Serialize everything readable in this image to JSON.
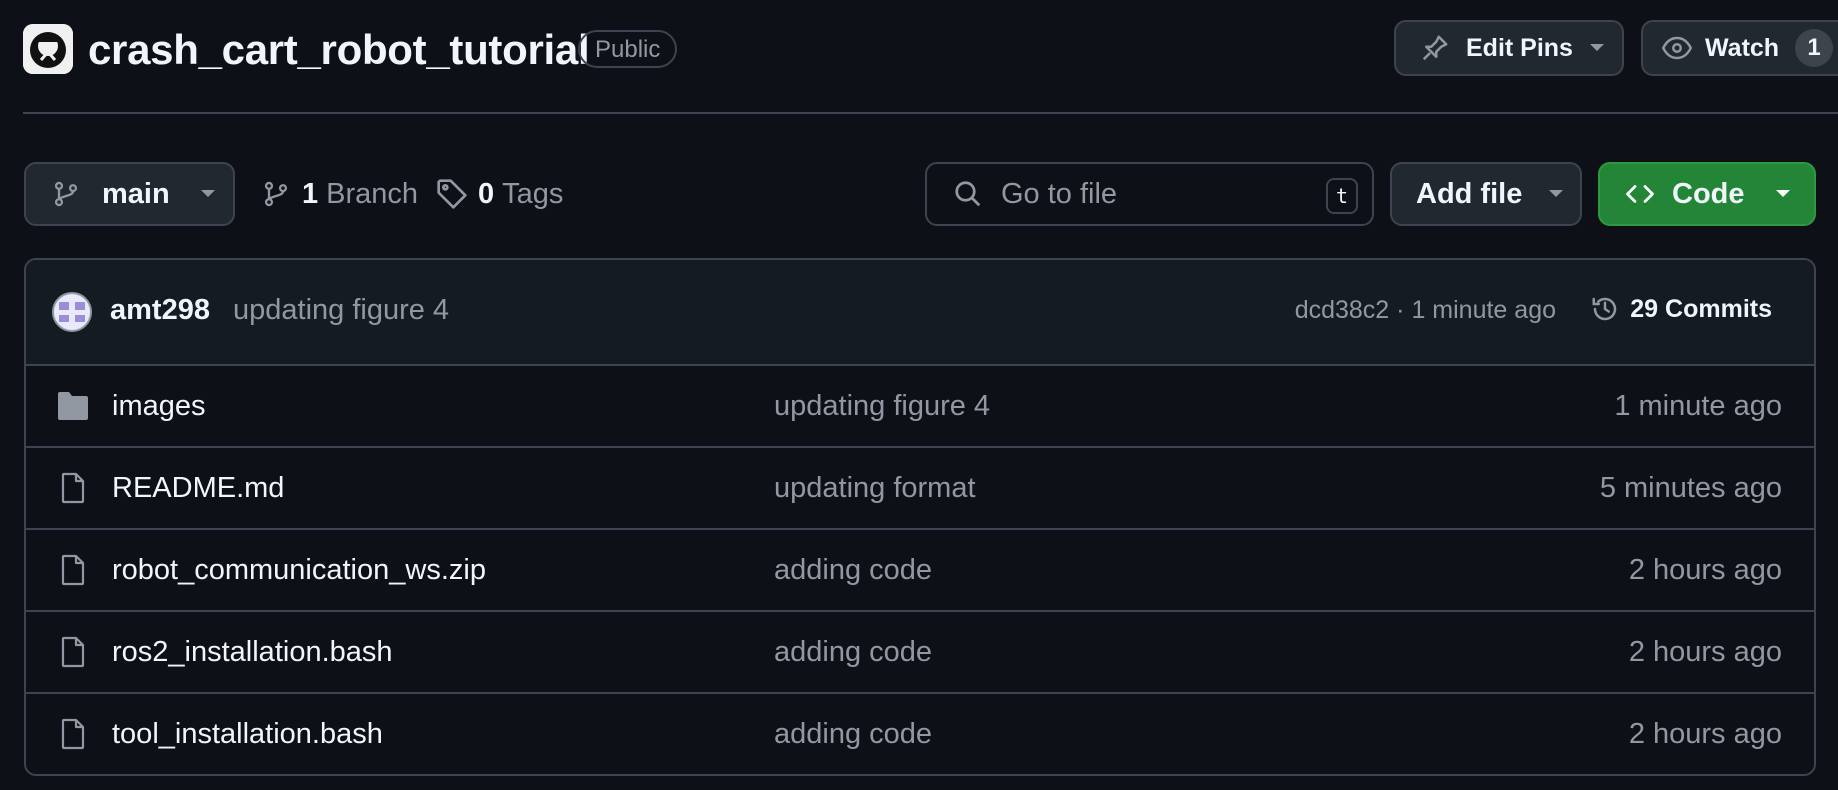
{
  "repo": {
    "name": "crash_cart_robot_tutorial",
    "visibility": "Public",
    "edit_pins_label": "Edit Pins",
    "watch_label": "Watch",
    "watch_count": "1"
  },
  "toolbar": {
    "branch": "main",
    "branch_count": "1",
    "branch_label": "Branch",
    "tag_count": "0",
    "tag_label": "Tags",
    "search_placeholder": "Go to file",
    "search_shortcut": "t",
    "add_file_label": "Add file",
    "code_label": "Code",
    "code_button_color": "#238636"
  },
  "latest_commit": {
    "author": "amt298",
    "message": "updating figure 4",
    "sha": "dcd38c2",
    "separator": "·",
    "time": "1 minute ago",
    "commits_count": "29",
    "commits_label": "Commits"
  },
  "files": [
    {
      "icon": "folder-icon",
      "name": "images",
      "message": "updating figure 4",
      "age": "1 minute ago"
    },
    {
      "icon": "file-icon",
      "name": "README.md",
      "message": "updating format",
      "age": "5 minutes ago"
    },
    {
      "icon": "file-icon",
      "name": "robot_communication_ws.zip",
      "message": "adding code",
      "age": "2 hours ago"
    },
    {
      "icon": "file-icon",
      "name": "ros2_installation.bash",
      "message": "adding code",
      "age": "2 hours ago"
    },
    {
      "icon": "file-icon",
      "name": "tool_installation.bash",
      "message": "adding code",
      "age": "2 hours ago"
    }
  ],
  "theme": {
    "background": "#0d1117",
    "border": "#3d444d",
    "muted_text": "#9198a1",
    "avatar_color": "#9b8ed6"
  }
}
